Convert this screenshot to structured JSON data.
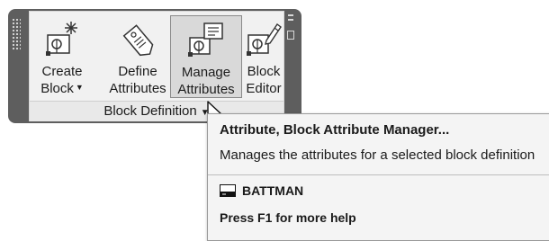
{
  "ribbon": {
    "buttons": [
      {
        "line1": "Create",
        "line2": "Block",
        "dropdown": true,
        "icon": "create-block-icon"
      },
      {
        "line1": "Define",
        "line2": "Attributes",
        "icon": "define-attributes-icon"
      },
      {
        "line1": "Manage",
        "line2": "Attributes",
        "icon": "manage-attributes-icon"
      },
      {
        "line1": "Block",
        "line2": "Editor",
        "icon": "block-editor-icon"
      }
    ],
    "panel_title": "Block Definition"
  },
  "tooltip": {
    "title": "Attribute, Block Attribute Manager...",
    "description": "Manages the attributes for a selected block definition",
    "command": "BATTMAN",
    "help": "Press F1 for more help"
  },
  "colors": {
    "ribbon_frame": "#5e5e5e",
    "ribbon_background": "#f1f1f1",
    "active_button": "#d9d9d9",
    "tooltip_background": "#f4f4f4"
  }
}
